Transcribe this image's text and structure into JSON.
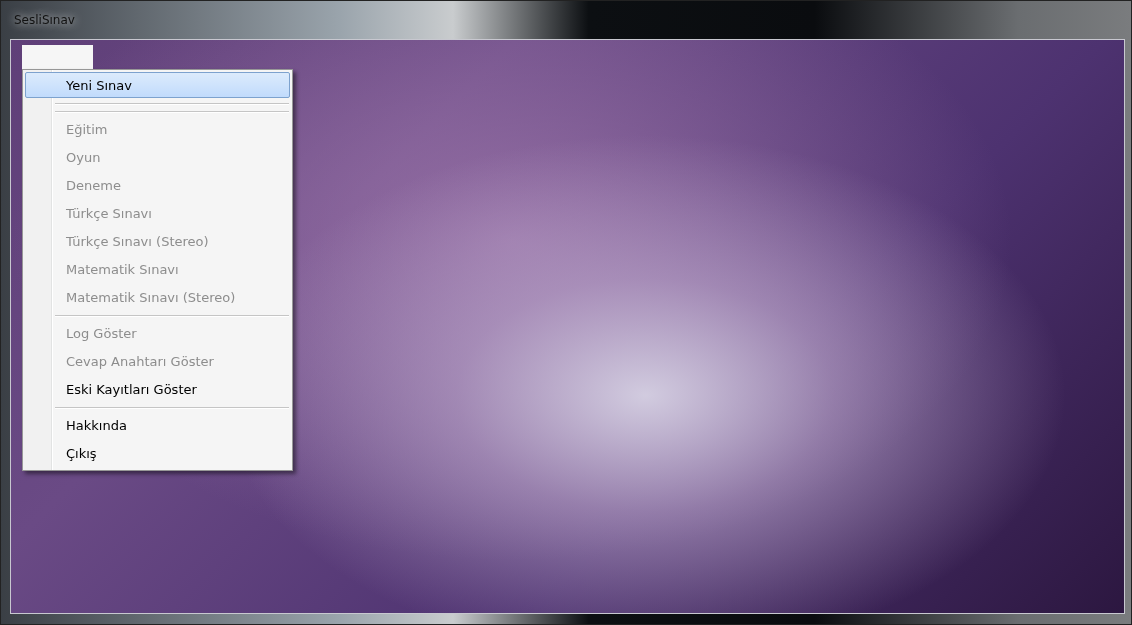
{
  "window": {
    "title": "SesliSınav"
  },
  "menu": {
    "items": [
      {
        "kind": "item",
        "label": "Yeni Sınav",
        "selected": true,
        "disabled": false
      },
      {
        "kind": "separator"
      },
      {
        "kind": "separator"
      },
      {
        "kind": "item",
        "label": "Eğitim",
        "selected": false,
        "disabled": true
      },
      {
        "kind": "item",
        "label": "Oyun",
        "selected": false,
        "disabled": true
      },
      {
        "kind": "item",
        "label": "Deneme",
        "selected": false,
        "disabled": true
      },
      {
        "kind": "item",
        "label": "Türkçe Sınavı",
        "selected": false,
        "disabled": true
      },
      {
        "kind": "item",
        "label": "Türkçe Sınavı (Stereo)",
        "selected": false,
        "disabled": true
      },
      {
        "kind": "item",
        "label": "Matematik Sınavı",
        "selected": false,
        "disabled": true
      },
      {
        "kind": "item",
        "label": "Matematik Sınavı (Stereo)",
        "selected": false,
        "disabled": true
      },
      {
        "kind": "separator"
      },
      {
        "kind": "item",
        "label": "Log Göster",
        "selected": false,
        "disabled": true
      },
      {
        "kind": "item",
        "label": "Cevap Anahtarı Göster",
        "selected": false,
        "disabled": true
      },
      {
        "kind": "item",
        "label": "Eski Kayıtları Göster",
        "selected": false,
        "disabled": false
      },
      {
        "kind": "separator"
      },
      {
        "kind": "item",
        "label": "Hakkında",
        "selected": false,
        "disabled": false
      },
      {
        "kind": "item",
        "label": "Çıkış",
        "selected": false,
        "disabled": false
      }
    ]
  }
}
